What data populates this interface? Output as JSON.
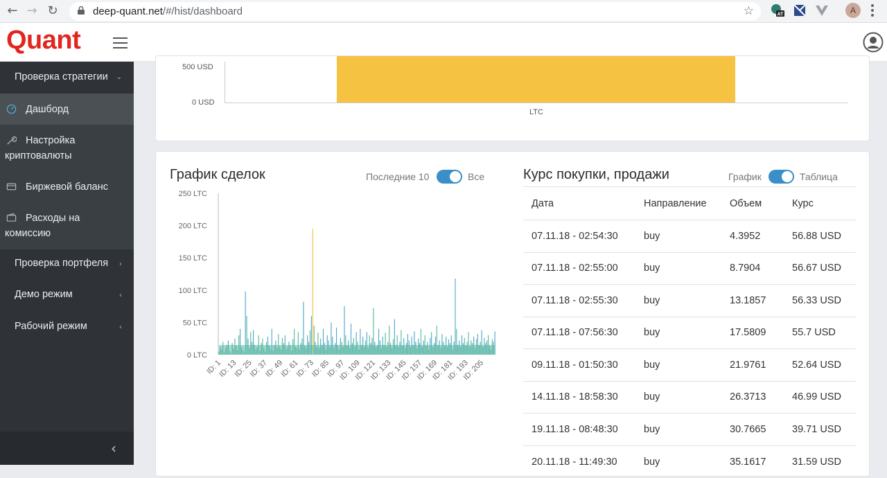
{
  "browser": {
    "url_host": "deep-quant.net",
    "url_path": "/#/hist/dashboard",
    "back_icon": "back-arrow-icon",
    "forward_icon": "forward-arrow-icon",
    "reload_icon": "reload-icon",
    "ext_badge": "AT",
    "profile_initial": "A"
  },
  "app": {
    "logo": "Quant",
    "brand_color": "#e2261e"
  },
  "sidebar": {
    "items": [
      {
        "label": "Проверка стратегии",
        "expanded": true
      },
      {
        "label": "Дашборд",
        "icon": "speedometer-icon",
        "active": true
      },
      {
        "label": "Настройка криптовалюты",
        "line1": "Настройка",
        "line2": "криптовалюты",
        "icon": "wrench-icon"
      },
      {
        "label": "Биржевой баланс",
        "icon": "card-icon"
      },
      {
        "label": "Расходы на комиссию",
        "line1": "Расходы на",
        "line2": "комиссию",
        "icon": "wallet-icon"
      },
      {
        "label": "Проверка портфеля"
      },
      {
        "label": "Демо режим"
      },
      {
        "label": "Рабочий режим"
      }
    ]
  },
  "top_chart": {
    "y_ticks": [
      "500 USD",
      "0 USD"
    ],
    "category": "LTC",
    "bar_color": "#f5c242"
  },
  "deals": {
    "title": "График сделок",
    "toggle_left": "Последние 10",
    "toggle_right": "Все"
  },
  "rates": {
    "title": "Курс покупки, продажи",
    "toggle_left": "График",
    "toggle_right": "Таблица",
    "columns": [
      "Дата",
      "Направление",
      "Объем",
      "Курс"
    ],
    "rows": [
      [
        "07.11.18 - 02:54:30",
        "buy",
        "4.3952",
        "56.88 USD"
      ],
      [
        "07.11.18 - 02:55:00",
        "buy",
        "8.7904",
        "56.67 USD"
      ],
      [
        "07.11.18 - 02:55:30",
        "buy",
        "13.1857",
        "56.33 USD"
      ],
      [
        "07.11.18 - 07:56:30",
        "buy",
        "17.5809",
        "55.7 USD"
      ],
      [
        "09.11.18 - 01:50:30",
        "buy",
        "21.9761",
        "52.64 USD"
      ],
      [
        "14.11.18 - 18:58:30",
        "buy",
        "26.3713",
        "46.99 USD"
      ],
      [
        "19.11.18 - 08:48:30",
        "buy",
        "30.7665",
        "39.71 USD"
      ],
      [
        "20.11.18 - 11:49:30",
        "buy",
        "35.1617",
        "31.59 USD"
      ]
    ]
  },
  "chart_data": [
    {
      "type": "bar",
      "categories": [
        "LTC"
      ],
      "values": [
        580
      ],
      "ylabel": "",
      "y_ticks": [
        "0 USD",
        "500 USD"
      ],
      "colors": [
        "#f5c242"
      ]
    },
    {
      "type": "bar",
      "title": "График сделок",
      "ylim": [
        0,
        250
      ],
      "y_ticks": [
        "0 LTC",
        "50 LTC",
        "100 LTC",
        "150 LTC",
        "200 LTC",
        "250 LTC"
      ],
      "x_ticks": [
        "ID: 1",
        "ID: 13",
        "ID: 25",
        "ID: 37",
        "ID: 49",
        "ID: 61",
        "ID: 73",
        "ID: 85",
        "ID: 97",
        "ID: 109",
        "ID: 121",
        "ID: 133",
        "ID: 145",
        "ID: 157",
        "ID: 169",
        "ID: 181",
        "ID: 193",
        "ID: 205"
      ],
      "colors": [
        "#4da8c9",
        "#5ab89a",
        "#f5c242"
      ],
      "values": [
        5,
        12,
        8,
        20,
        4,
        10,
        15,
        22,
        6,
        3,
        18,
        9,
        25,
        14,
        7,
        30,
        40,
        12,
        8,
        5,
        98,
        60,
        25,
        10,
        35,
        20,
        38,
        15,
        8,
        12,
        30,
        6,
        18,
        25,
        10,
        5,
        20,
        28,
        14,
        8,
        40,
        6,
        15,
        22,
        10,
        32,
        12,
        8,
        26,
        18,
        30,
        8,
        12,
        20,
        15,
        6,
        24,
        40,
        12,
        10,
        35,
        8,
        18,
        25,
        82,
        14,
        10,
        30,
        20,
        38,
        60,
        195,
        45,
        20,
        12,
        34,
        10,
        25,
        15,
        40,
        18,
        8,
        30,
        22,
        12,
        50,
        28,
        10,
        18,
        42,
        15,
        8,
        26,
        20,
        12,
        75,
        30,
        14,
        22,
        10,
        48,
        18,
        26,
        12,
        35,
        20,
        8,
        40,
        15,
        28,
        12,
        22,
        35,
        10,
        30,
        18,
        26,
        72,
        20,
        12,
        15,
        40,
        22,
        10,
        28,
        15,
        34,
        12,
        20,
        45,
        18,
        10,
        24,
        55,
        15,
        30,
        12,
        20,
        38,
        14,
        26,
        10,
        18,
        32,
        22,
        12,
        28,
        15,
        36,
        20,
        10,
        25,
        18,
        40,
        12,
        22,
        30,
        14,
        20,
        8,
        26,
        35,
        12,
        18,
        28,
        45,
        15,
        22,
        10,
        32,
        20,
        14,
        28,
        12,
        24,
        18,
        30,
        8,
        20,
        118,
        40,
        15,
        22,
        12,
        30,
        18,
        26,
        14,
        20,
        35,
        12,
        22,
        18,
        28,
        10,
        24,
        32,
        15,
        20,
        38,
        12,
        26,
        18,
        22,
        30,
        14,
        8,
        24,
        20,
        36
      ]
    }
  ]
}
